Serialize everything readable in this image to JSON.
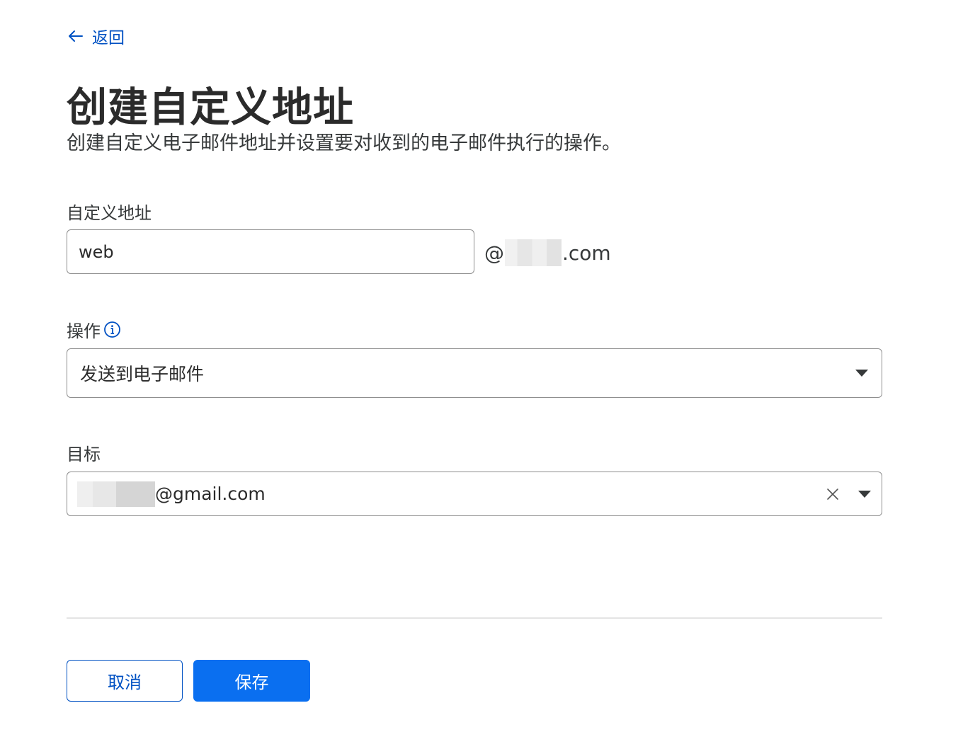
{
  "nav": {
    "back_label": "返回"
  },
  "page": {
    "title": "创建自定义地址",
    "subtitle": "创建自定义电子邮件地址并设置要对收到的电子邮件执行的操作。"
  },
  "form": {
    "address": {
      "label": "自定义地址",
      "value": "web",
      "domain_prefix": "@",
      "domain_suffix": ".com"
    },
    "action": {
      "label": "操作",
      "info_icon": "info-circle-icon",
      "selected": "发送到电子邮件"
    },
    "target": {
      "label": "目标",
      "value_suffix": "@gmail.com"
    }
  },
  "buttons": {
    "cancel_label": "取消",
    "save_label": "保存"
  },
  "colors": {
    "accent": "#0051c3",
    "primary_button": "#0a6ff0",
    "border": "#8e8e8e"
  }
}
